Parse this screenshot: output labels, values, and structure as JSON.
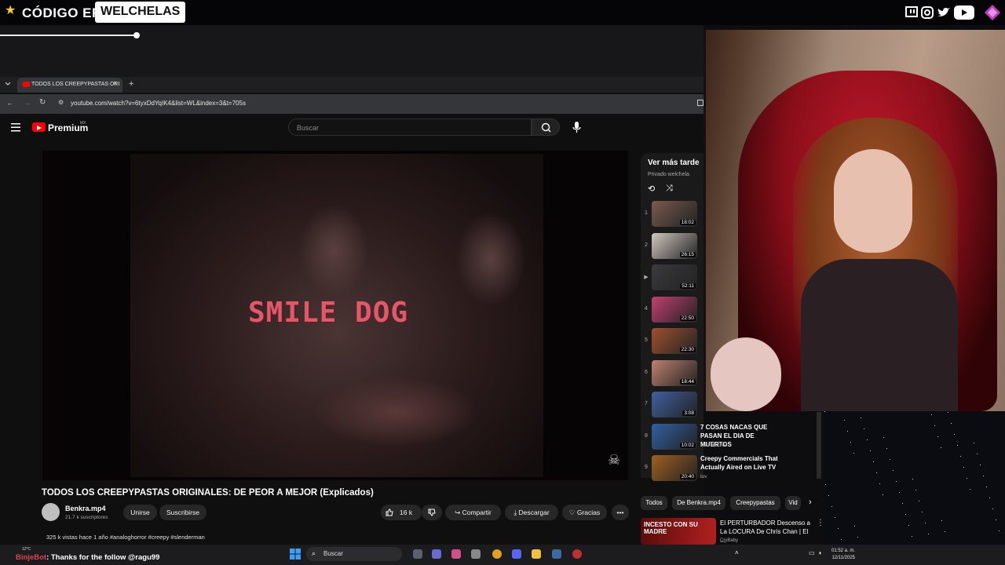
{
  "overlay": {
    "brand_code": "CÓDIGO EPIC",
    "brand_name": "WELCHELAS",
    "social_icons": [
      "twitch-icon",
      "instagram-icon",
      "twitter-icon",
      "youtube-icon",
      "gem-icon"
    ]
  },
  "browser": {
    "tab_title": "TODOS LOS CREEPYPASTAS ORI",
    "new_tab": "+",
    "url": "youtube.com/watch?v=6tyxDdYqIK4&list=WL&index=3&t=705s"
  },
  "youtube": {
    "logo_text": "Premium",
    "region": "MX",
    "search_placeholder": "Buscar",
    "video_overlay_text": "SMILE DOG",
    "video_title": "TODOS LOS CREEPYPASTAS ORIGINALES: DE PEOR A MEJOR (Explicados)",
    "channel_name": "Benkra.mp4",
    "channel_subs": "21.7 k suscriptores",
    "join": "Unirse",
    "subscribe": "Suscribirse",
    "likes": "16 k",
    "share": "Compartir",
    "download": "Descargar",
    "thanks": "Gracias",
    "meta": "325 k vistas  hace 1 año  #analoghorror #creepy #slenderman"
  },
  "playlist": {
    "title": "Ver más tarde",
    "privacy": "Privado  welchela",
    "items": [
      {
        "index": "1",
        "duration": "18:02",
        "title": "",
        "channel": ""
      },
      {
        "index": "2",
        "duration": "26:15",
        "title": "",
        "channel": ""
      },
      {
        "index": "▶",
        "duration": "52:11",
        "title": "",
        "channel": ""
      },
      {
        "index": "4",
        "duration": "22:50",
        "title": "",
        "channel": ""
      },
      {
        "index": "5",
        "duration": "22:30",
        "title": "",
        "channel": ""
      },
      {
        "index": "6",
        "duration": "18:44",
        "title": "",
        "channel": ""
      },
      {
        "index": "7",
        "duration": "3:08",
        "title": "",
        "channel": ""
      },
      {
        "index": "8",
        "duration": "10:02",
        "title": "7 COSAS NACAS QUE PASAN EL DIA DE MUERTOS",
        "channel": "Asu Mecha!"
      },
      {
        "index": "9",
        "duration": "20:40",
        "title": "Creepy Commercials That Actually Aired on Live TV",
        "channel": "tuv"
      }
    ]
  },
  "chips": [
    "Todos",
    "De Benkra.mp4",
    "Creepypastas",
    "Vid"
  ],
  "recommended": {
    "thumb_text": "INCESTO CON SU MADRE",
    "title": "El PERTURBADOR Descenso a La LOCURA De Chris Chan | El ...",
    "channel": "CryBaby"
  },
  "chat": {
    "user": "BinjeBot",
    "message": ": Thanks for the follow @ragu99"
  },
  "taskbar": {
    "weather": "12°C",
    "search": "Buscar",
    "time": "01:52 a. m.",
    "date": "12/11/2025"
  }
}
